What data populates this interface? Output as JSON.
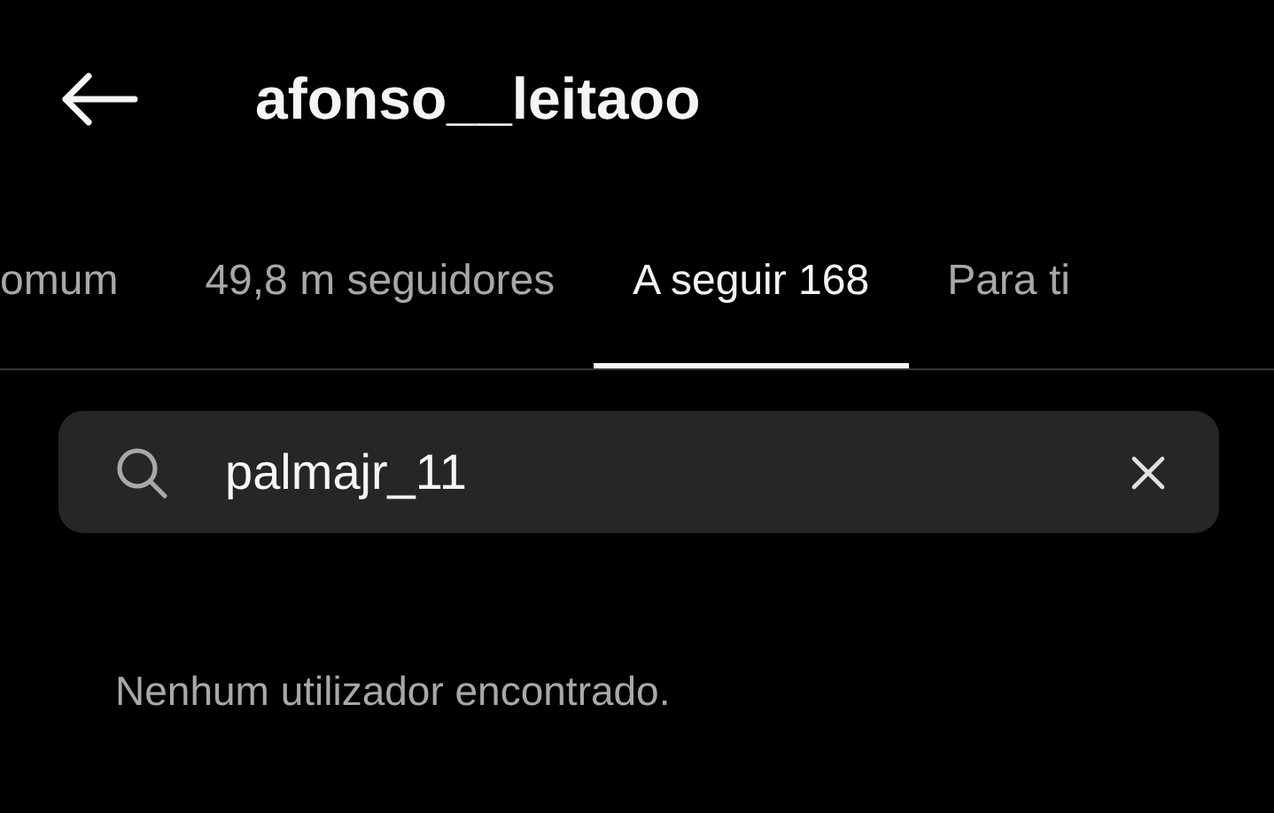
{
  "header": {
    "title": "afonso__leitaoo"
  },
  "tabs": [
    {
      "label": "omum",
      "selected": false
    },
    {
      "label": "49,8 m seguidores",
      "selected": false
    },
    {
      "label": "A seguir 168",
      "selected": true
    },
    {
      "label": "Para ti",
      "selected": false
    }
  ],
  "search": {
    "value": "palmajr_11"
  },
  "message": "Nenhum utilizador encontrado."
}
